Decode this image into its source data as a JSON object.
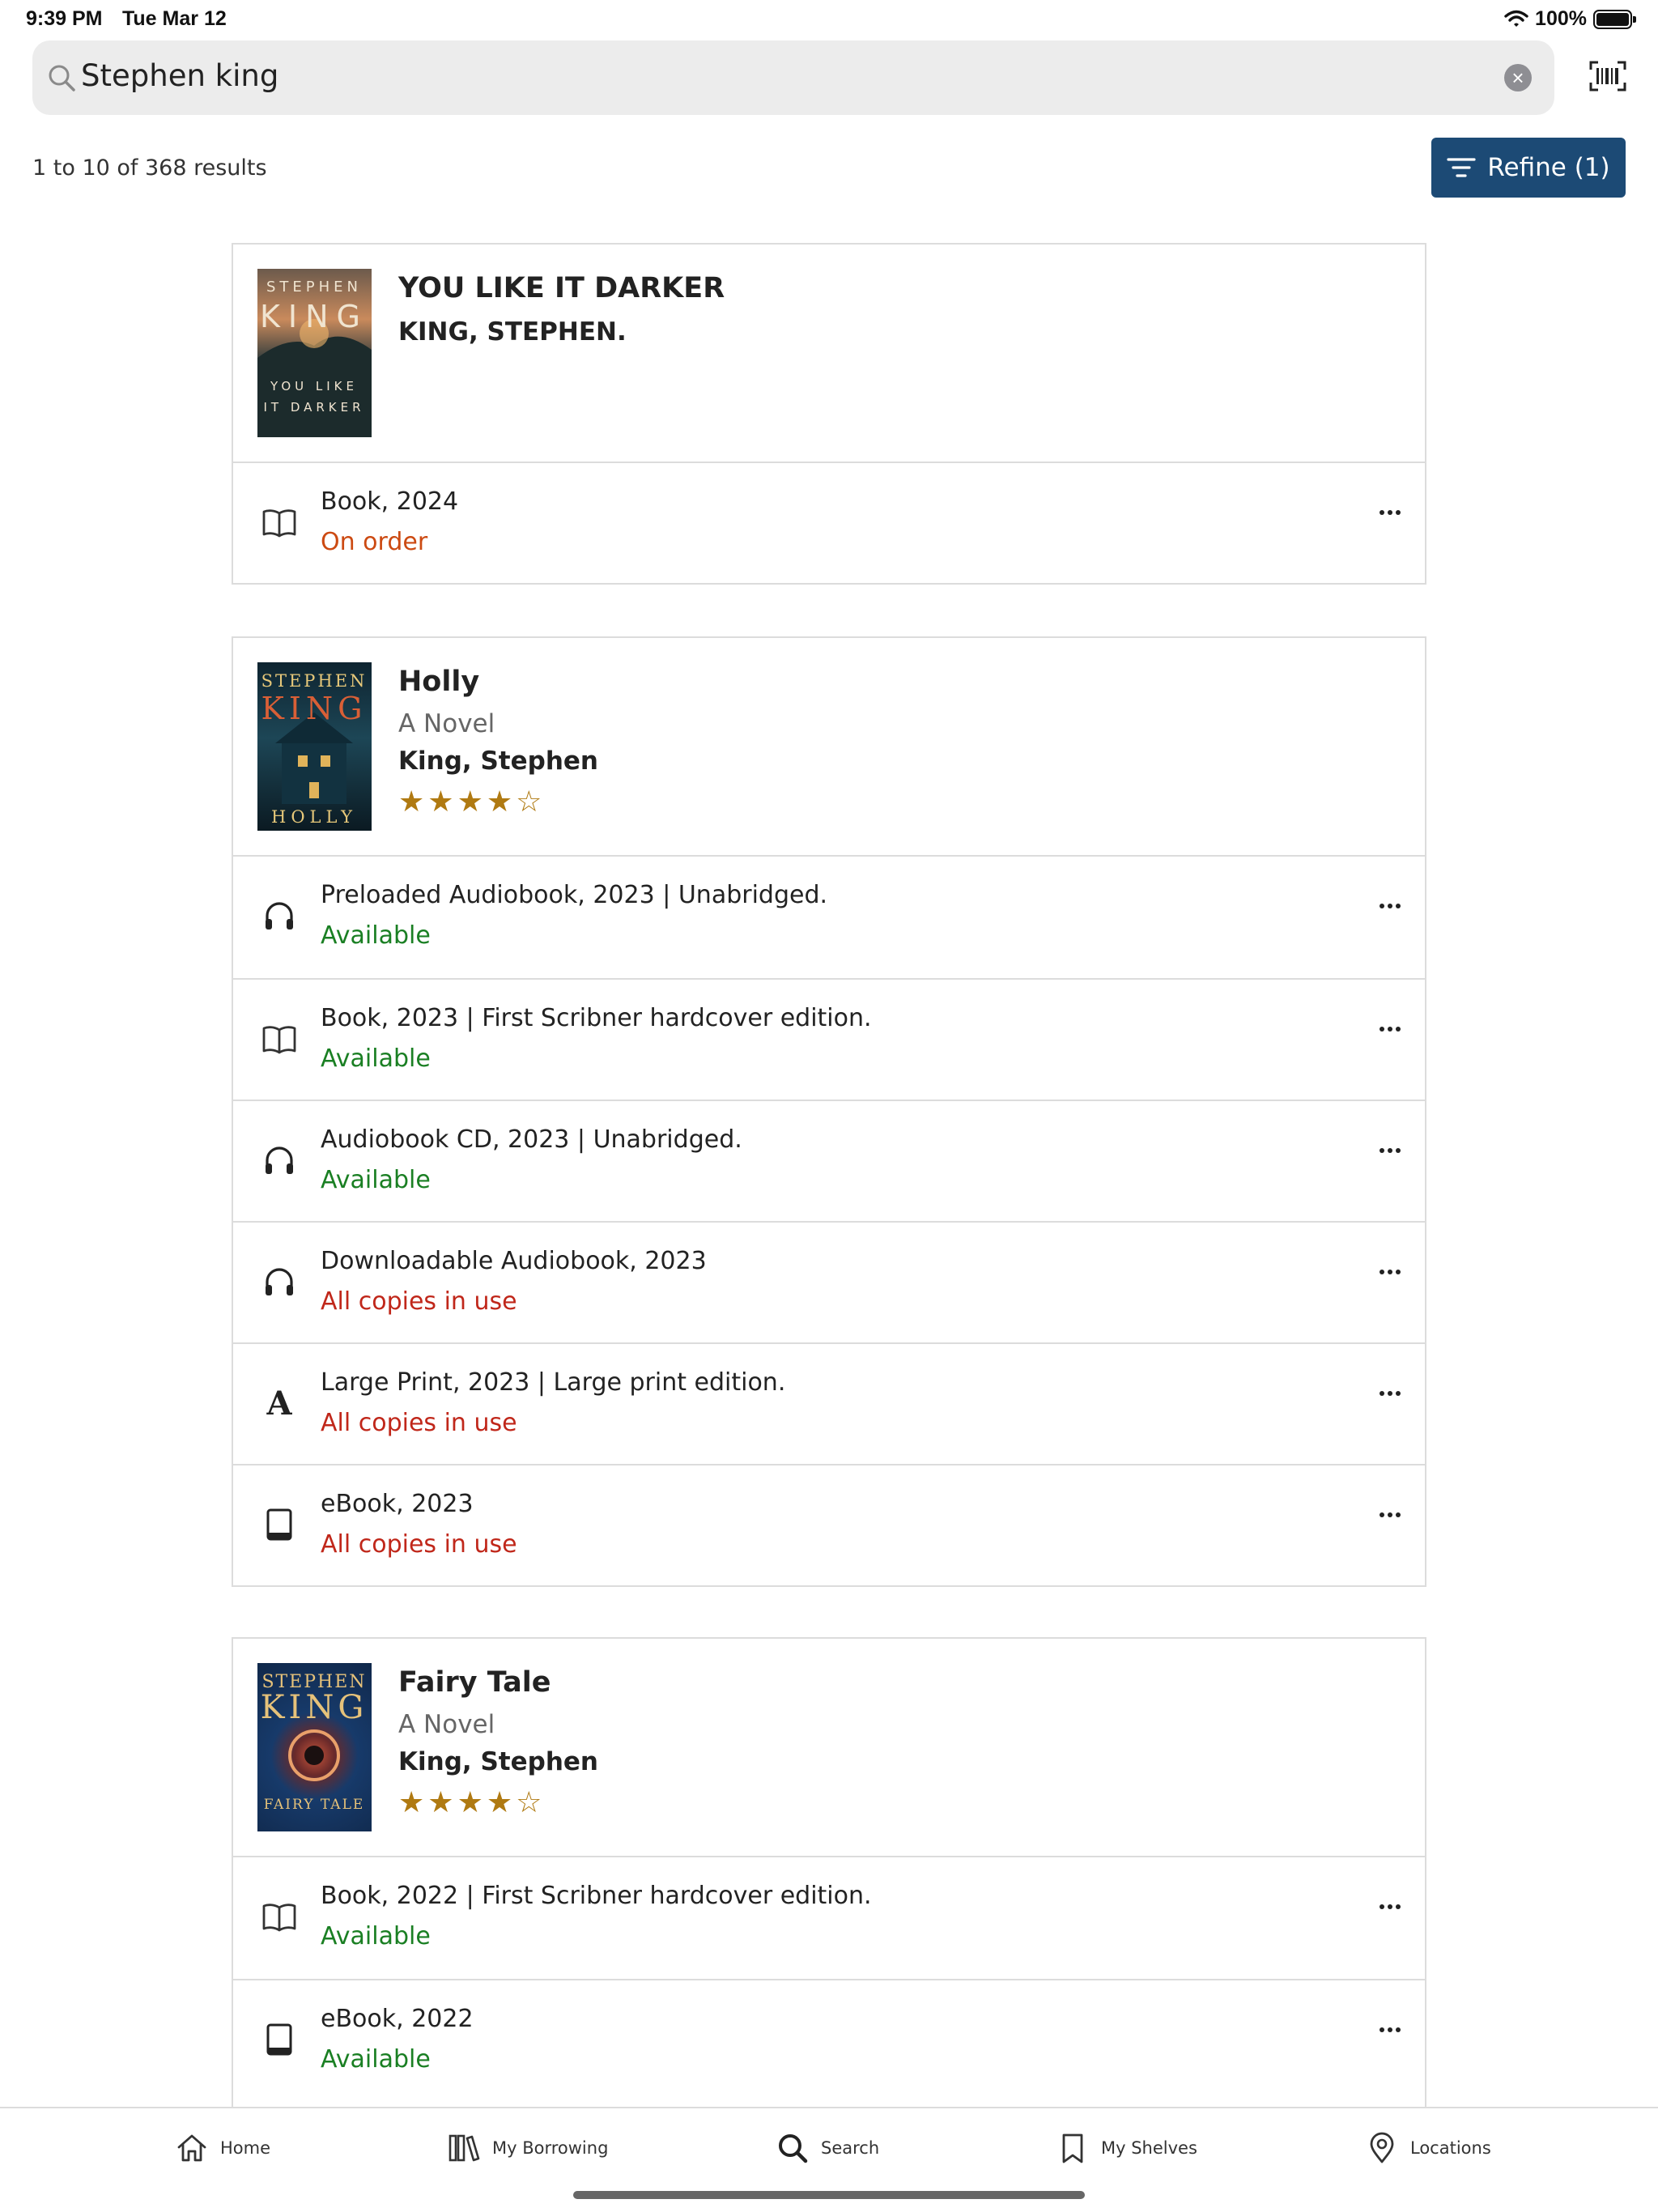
{
  "status_bar": {
    "time": "9:39 PM",
    "date": "Tue Mar 12",
    "battery": "100%"
  },
  "search": {
    "query": "Stephen king"
  },
  "results": {
    "count_text": "1 to 10 of 368 results",
    "refine_label": "Refine (1)"
  },
  "cards": [
    {
      "title": "YOU LIKE IT DARKER",
      "author": "KING, STEPHEN.",
      "cover": {
        "line1": "STEPHEN",
        "line2": "KING",
        "line3": "YOU LIKE",
        "line4": "IT DARKER"
      },
      "formats": [
        {
          "format": "Book, 2024",
          "status": "On order",
          "icon": "book-icon"
        }
      ]
    },
    {
      "title": "Holly",
      "subtitle": "A Novel",
      "author": "King, Stephen",
      "rating": 4,
      "cover": {
        "line1": "STEPHEN",
        "line2": "KING",
        "line3": "HOLLY"
      },
      "formats": [
        {
          "format": "Preloaded Audiobook, 2023 | Unabridged.",
          "status": "Available",
          "icon": "headphones-icon"
        },
        {
          "format": "Book, 2023 | First Scribner hardcover edition.",
          "status": "Available",
          "icon": "book-icon"
        },
        {
          "format": "Audiobook CD, 2023 | Unabridged.",
          "status": "Available",
          "icon": "headphones-icon"
        },
        {
          "format": "Downloadable Audiobook, 2023",
          "status": "All copies in use",
          "icon": "headphones-icon"
        },
        {
          "format": "Large Print, 2023 | Large print edition.",
          "status": "All copies in use",
          "icon": "large-print-icon"
        },
        {
          "format": "eBook, 2023",
          "status": "All copies in use",
          "icon": "tablet-icon"
        }
      ]
    },
    {
      "title": "Fairy Tale",
      "subtitle": "A Novel",
      "author": "King, Stephen",
      "rating": 4,
      "cover": {
        "line1": "STEPHEN",
        "line2": "KING",
        "line3": "FAIRY TALE"
      },
      "formats": [
        {
          "format": "Book, 2022 | First Scribner hardcover edition.",
          "status": "Available",
          "icon": "book-icon"
        },
        {
          "format": "eBook, 2022",
          "status": "Available",
          "icon": "tablet-icon"
        }
      ]
    }
  ],
  "colors": {
    "accent": "#1c4a75",
    "available": "#1a7f23",
    "in_use": "#c0271a",
    "on_order": "#cc4a12",
    "star": "#b07a12"
  },
  "tabs": [
    {
      "label": "Home",
      "icon": "home-icon"
    },
    {
      "label": "My Borrowing",
      "icon": "books-icon"
    },
    {
      "label": "Search",
      "icon": "search-icon"
    },
    {
      "label": "My Shelves",
      "icon": "bookmark-icon"
    },
    {
      "label": "Locations",
      "icon": "location-pin-icon"
    }
  ]
}
